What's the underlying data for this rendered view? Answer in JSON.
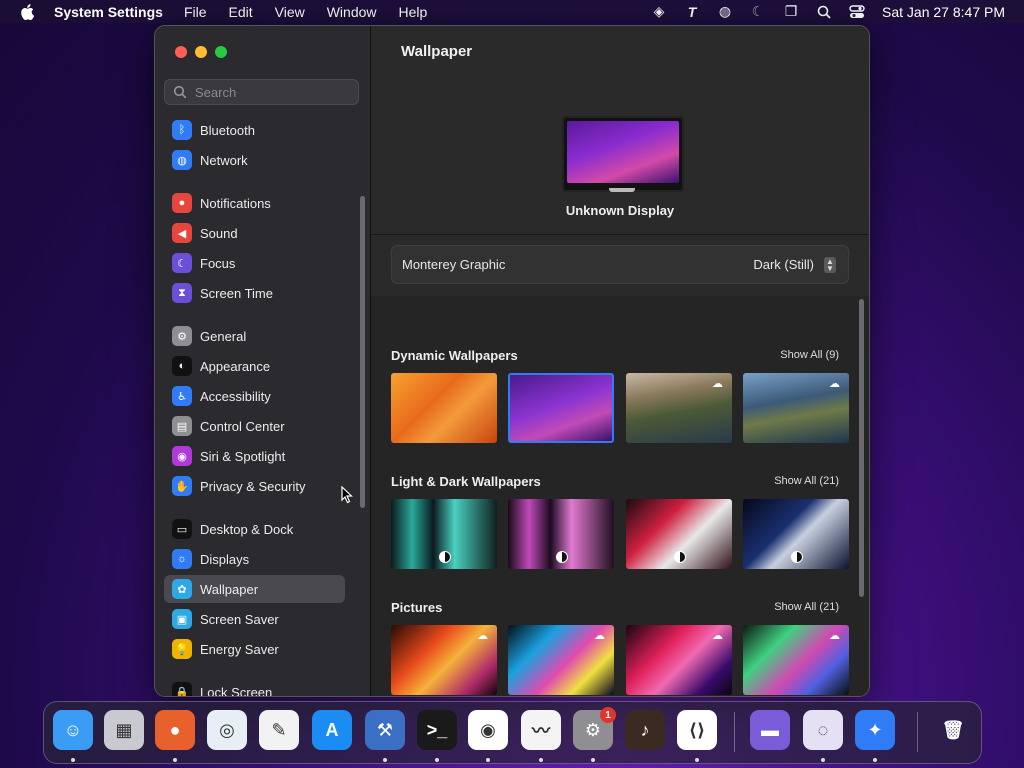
{
  "menubar": {
    "app_name": "System Settings",
    "menus": [
      "File",
      "Edit",
      "View",
      "Window",
      "Help"
    ],
    "clock": "Sat Jan 27  8:47 PM"
  },
  "sidebar": {
    "search_placeholder": "Search",
    "items": [
      {
        "label": "Bluetooth",
        "color": "#2f7cf6",
        "glyph": "ᛒ"
      },
      {
        "label": "Network",
        "color": "#2f7cf6",
        "glyph": "◍"
      },
      {
        "label": "Notifications",
        "color": "#e8453c",
        "glyph": "●"
      },
      {
        "label": "Sound",
        "color": "#e8453c",
        "glyph": "◀"
      },
      {
        "label": "Focus",
        "color": "#6b4fd8",
        "glyph": "☾"
      },
      {
        "label": "Screen Time",
        "color": "#6b4fd8",
        "glyph": "⧗"
      },
      {
        "label": "General",
        "color": "#8e8e93",
        "glyph": "⚙"
      },
      {
        "label": "Appearance",
        "color": "#111111",
        "glyph": "◐"
      },
      {
        "label": "Accessibility",
        "color": "#2f7cf6",
        "glyph": "♿"
      },
      {
        "label": "Control Center",
        "color": "#8e8e93",
        "glyph": "▤"
      },
      {
        "label": "Siri & Spotlight",
        "color": "#b03ad8",
        "glyph": "◉"
      },
      {
        "label": "Privacy & Security",
        "color": "#2f7cf6",
        "glyph": "✋"
      },
      {
        "label": "Desktop & Dock",
        "color": "#111111",
        "glyph": "▭"
      },
      {
        "label": "Displays",
        "color": "#2f7cf6",
        "glyph": "☼"
      },
      {
        "label": "Wallpaper",
        "color": "#2fa8e8",
        "glyph": "✿"
      },
      {
        "label": "Screen Saver",
        "color": "#2fa8e8",
        "glyph": "▣"
      },
      {
        "label": "Energy Saver",
        "color": "#f0b400",
        "glyph": "💡"
      },
      {
        "label": "Lock Screen",
        "color": "#111111",
        "glyph": "🔒"
      }
    ],
    "selected": "Wallpaper"
  },
  "main": {
    "title": "Wallpaper",
    "display_name": "Unknown Display",
    "wallpaper_name": "Monterey Graphic",
    "wallpaper_mode": "Dark (Still)",
    "sections": [
      {
        "title": "Dynamic Wallpapers",
        "show_all": "Show All (9)"
      },
      {
        "title": "Light & Dark Wallpapers",
        "show_all": "Show All (21)"
      },
      {
        "title": "Pictures",
        "show_all": "Show All (21)"
      }
    ]
  },
  "dock": {
    "apps": [
      {
        "name": "Finder",
        "color": "#3b9cf5",
        "glyph": "☺"
      },
      {
        "name": "Launchpad",
        "color": "#c9c9d2",
        "glyph": "▦"
      },
      {
        "name": "Firefox",
        "color": "#e8602c",
        "glyph": "●"
      },
      {
        "name": "Safari",
        "color": "#e8eef5",
        "glyph": "◎"
      },
      {
        "name": "TextEdit",
        "color": "#f2f2f2",
        "glyph": "✎"
      },
      {
        "name": "App Store",
        "color": "#1c8cf5",
        "glyph": "A"
      },
      {
        "name": "Xcode Tools",
        "color": "#3a6fc4",
        "glyph": "⚒"
      },
      {
        "name": "Terminal",
        "color": "#1a1a1a",
        "glyph": ">_"
      },
      {
        "name": "Chrome",
        "color": "#ffffff",
        "glyph": "◉"
      },
      {
        "name": "Freeform",
        "color": "#f4f4f4",
        "glyph": "〰"
      },
      {
        "name": "System Settings",
        "color": "#8e8e93",
        "glyph": "⚙",
        "badge": "1"
      },
      {
        "name": "GarageBand",
        "color": "#3a2a22",
        "glyph": "♪"
      },
      {
        "name": "VS Code",
        "color": "#ffffff",
        "glyph": "⟨⟩"
      },
      {
        "name": "Disk Utility",
        "color": "#7b5cd8",
        "glyph": "▬"
      },
      {
        "name": "Tor Browser",
        "color": "#e6e0f5",
        "glyph": "◌"
      },
      {
        "name": "Xcode Navigator",
        "color": "#2f7cf6",
        "glyph": "✦"
      },
      {
        "name": "Trash",
        "color": "#6e6e73",
        "glyph": "🗑"
      }
    ]
  }
}
